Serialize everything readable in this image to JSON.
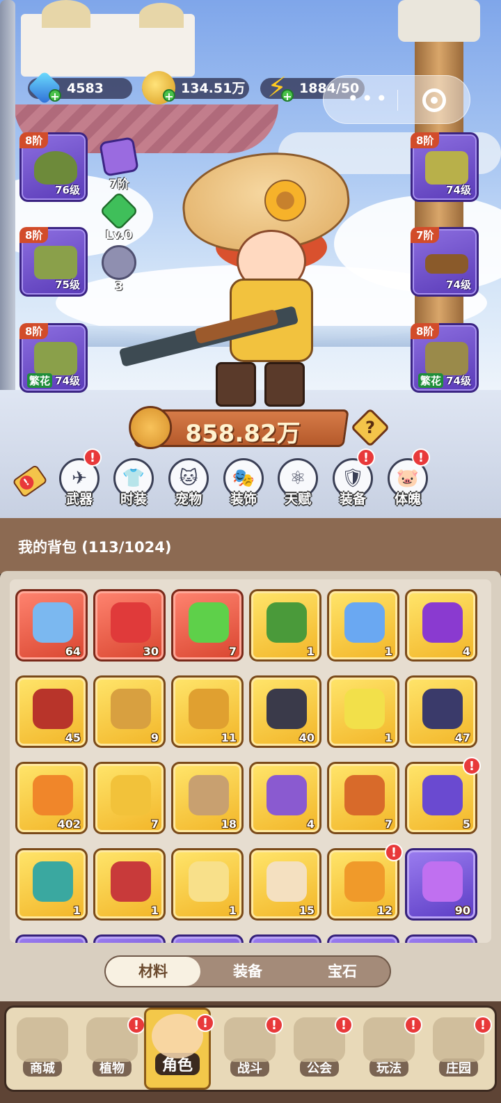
{
  "resources": {
    "gems": "4583",
    "coins": "134.51万",
    "energy": "1884/50",
    "plus": "+"
  },
  "capsule": {
    "more": "•••",
    "close_icon": "target-icon"
  },
  "equipment": {
    "left": [
      {
        "tier": "8阶",
        "level": "76级",
        "tag": "",
        "name": "hat"
      },
      {
        "tier": "8阶",
        "level": "75级",
        "tag": "",
        "name": "gloves"
      },
      {
        "tier": "8阶",
        "level": "74级",
        "tag": "繁花",
        "name": "pants"
      }
    ],
    "right": [
      {
        "tier": "8阶",
        "level": "74级",
        "tag": "",
        "name": "outfit"
      },
      {
        "tier": "7阶",
        "level": "74级",
        "tag": "",
        "name": "belt"
      },
      {
        "tier": "8阶",
        "level": "74级",
        "tag": "繁花",
        "name": "boots"
      }
    ],
    "mini": [
      {
        "label": "7阶",
        "color": "#9a6be0"
      },
      {
        "label": "Lv.0",
        "color": "#3fbf5a"
      },
      {
        "label": "3",
        "color": "#8f8fb0"
      }
    ]
  },
  "power": {
    "value": "858.82万",
    "help": "?"
  },
  "functions": [
    {
      "label": "武器",
      "icon": "✈",
      "alert": true
    },
    {
      "label": "时装",
      "icon": "👕",
      "alert": false
    },
    {
      "label": "宠物",
      "icon": "🐱",
      "alert": false
    },
    {
      "label": "装饰",
      "icon": "🎭",
      "alert": false
    },
    {
      "label": "天赋",
      "icon": "⚛",
      "alert": false
    },
    {
      "label": "装备",
      "icon": "🛡",
      "alert": true
    },
    {
      "label": "体魄",
      "icon": "🐷",
      "alert": true
    }
  ],
  "alert_mark": "!",
  "backpack": {
    "title": "我的背包 (113/1024)",
    "items": [
      {
        "count": "64",
        "bg": "red",
        "color": "#7bb8f0"
      },
      {
        "count": "30",
        "bg": "red",
        "color": "#e03a3a"
      },
      {
        "count": "7",
        "bg": "red",
        "color": "#5ed04a"
      },
      {
        "count": "1",
        "bg": "gold",
        "color": "#4a9a3a"
      },
      {
        "count": "1",
        "bg": "gold",
        "color": "#6aa8f2"
      },
      {
        "count": "4",
        "bg": "gold",
        "color": "#8a3ad0"
      },
      {
        "count": "45",
        "bg": "gold",
        "color": "#b8342a"
      },
      {
        "count": "9",
        "bg": "gold",
        "color": "#d8a040"
      },
      {
        "count": "11",
        "bg": "gold",
        "color": "#e0a030"
      },
      {
        "count": "40",
        "bg": "gold",
        "color": "#3a3a4a"
      },
      {
        "count": "1",
        "bg": "gold",
        "color": "#f2e04a"
      },
      {
        "count": "47",
        "bg": "gold",
        "color": "#3a3a6a"
      },
      {
        "count": "402",
        "bg": "gold",
        "color": "#f0862a"
      },
      {
        "count": "7",
        "bg": "gold",
        "color": "#f2c23a"
      },
      {
        "count": "18",
        "bg": "gold",
        "color": "#c8a070"
      },
      {
        "count": "4",
        "bg": "gold",
        "color": "#8a5ad0"
      },
      {
        "count": "7",
        "bg": "gold",
        "color": "#d86a2a"
      },
      {
        "count": "5",
        "bg": "gold",
        "color": "#6a4ad0"
      },
      {
        "count": "1",
        "bg": "gold",
        "color": "#3aa8a0"
      },
      {
        "count": "1",
        "bg": "gold",
        "color": "#c83a3a"
      },
      {
        "count": "1",
        "bg": "gold",
        "color": "#f8e08a"
      },
      {
        "count": "15",
        "bg": "gold",
        "color": "#f4e0c0"
      },
      {
        "count": "12",
        "bg": "gold",
        "color": "#f09a2a"
      },
      {
        "count": "90",
        "bg": "purple",
        "color": "#c070f0"
      }
    ],
    "alerts_on": [
      17,
      22
    ]
  },
  "tabs": [
    {
      "label": "材料",
      "active": true
    },
    {
      "label": "装备",
      "active": false
    },
    {
      "label": "宝石",
      "active": false
    }
  ],
  "nav": [
    {
      "label": "商城",
      "alert": false,
      "active": false
    },
    {
      "label": "植物",
      "alert": true,
      "active": false
    },
    {
      "label": "角色",
      "alert": true,
      "active": true
    },
    {
      "label": "战斗",
      "alert": true,
      "active": false
    },
    {
      "label": "公会",
      "alert": true,
      "active": false
    },
    {
      "label": "玩法",
      "alert": true,
      "active": false
    },
    {
      "label": "庄园",
      "alert": true,
      "active": false
    }
  ]
}
